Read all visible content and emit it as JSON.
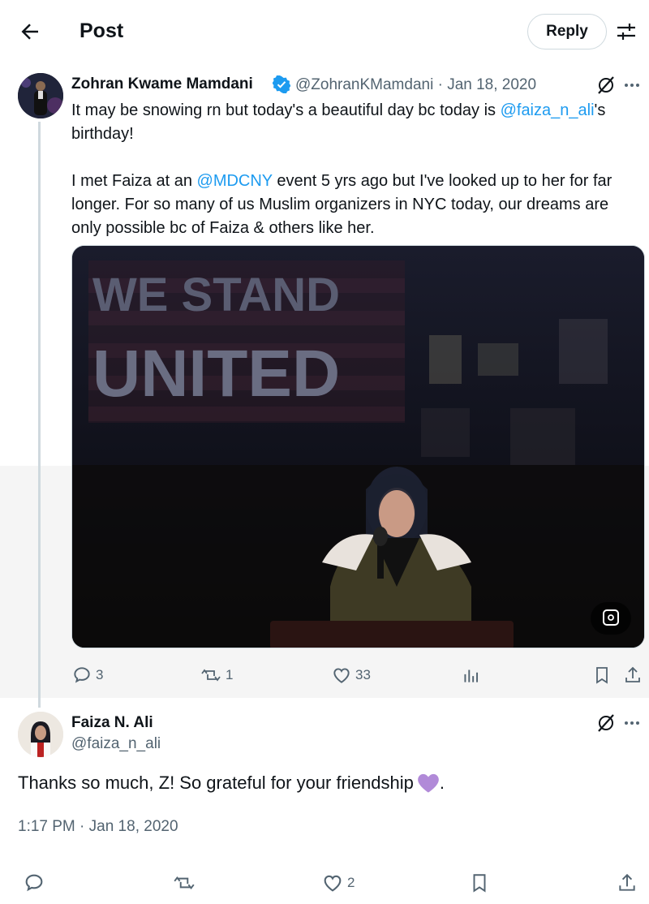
{
  "header": {
    "title": "Post",
    "reply_label": "Reply"
  },
  "main_tweet": {
    "author_name": "Zohran Kwame Mamdani",
    "meta": "@ZohranKMamdani · Jan 18, 2020",
    "text": {
      "p1_before": "It may be snowing rn but today's a beautiful day bc today is ",
      "p1_mention": "@faiza_n_ali",
      "p1_after": "'s birthday!",
      "p2_before": "I met Faiza at an ",
      "p2_mention": "@MDCNY",
      "p2_after": " event 5 yrs ago but I've looked up to her for far longer. For so many of us Muslim organizers in NYC today, our dreams are only possible bc of Faiza & others like her."
    },
    "image": {
      "banner_line1": "WE STAND",
      "banner_line2": "UNITED"
    },
    "stats": {
      "replies": "3",
      "reposts": "1",
      "likes": "33"
    }
  },
  "reply_tweet": {
    "author_name": "Faiza N. Ali",
    "handle": "@faiza_n_ali",
    "text": "Thanks so much, Z! So grateful for your friendship",
    "text_end": ".",
    "timestamp": "1:17 PM · Jan 18, 2020",
    "stats": {
      "likes": "2"
    }
  },
  "colors": {
    "accent": "#1d9bf0",
    "muted": "#536471",
    "heart_emoji": "#b18ad8"
  }
}
